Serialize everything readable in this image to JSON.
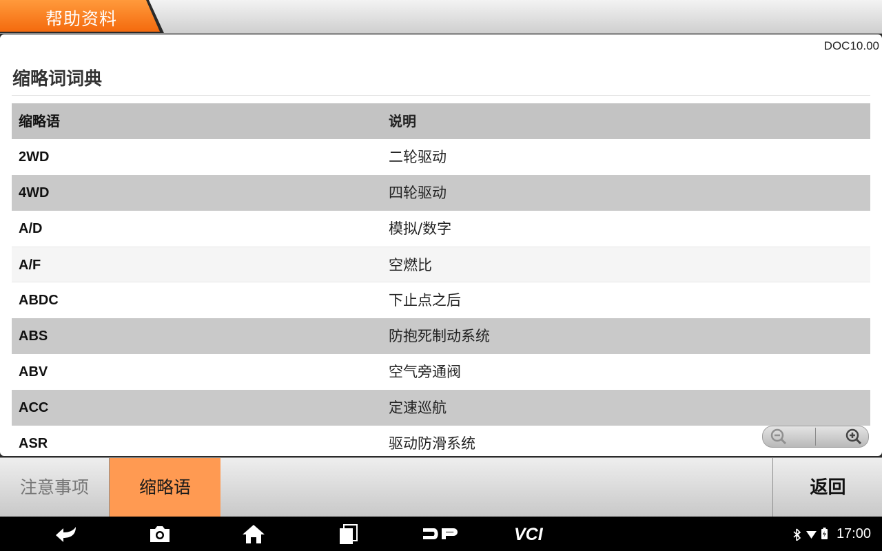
{
  "window": {
    "title": "帮助资料"
  },
  "document": {
    "version": "DOC10.00",
    "section_title": "缩略词词典"
  },
  "table": {
    "headers": [
      "缩略语",
      "说明"
    ],
    "rows": [
      {
        "abbr": "2WD",
        "desc": "二轮驱动"
      },
      {
        "abbr": "4WD",
        "desc": "四轮驱动"
      },
      {
        "abbr": "A/D",
        "desc": "模拟/数字"
      },
      {
        "abbr": "A/F",
        "desc": "空燃比"
      },
      {
        "abbr": "ABDC",
        "desc": "下止点之后"
      },
      {
        "abbr": "ABS",
        "desc": "防抱死制动系统"
      },
      {
        "abbr": "ABV",
        "desc": "空气旁通阀"
      },
      {
        "abbr": "ACC",
        "desc": "定速巡航"
      },
      {
        "abbr": "ASR",
        "desc": "驱动防滑系统"
      }
    ]
  },
  "zoom": {
    "out_icon": "zoom-out-icon",
    "in_icon": "zoom-in-icon"
  },
  "function_bar": {
    "notes_label": "注意事项",
    "abbr_label": "缩略语",
    "back_label": "返回",
    "active_color": "#ff9a52"
  },
  "nav_bar": {
    "icons": [
      "back-icon",
      "camera-icon",
      "home-icon",
      "recent-apps-icon",
      "dp-logo-icon",
      "vci-icon"
    ],
    "time": "17:00",
    "status_icons": [
      "bluetooth-icon",
      "wifi-icon",
      "battery-icon"
    ]
  },
  "colors": {
    "accent": "#ff7a1f",
    "header_row": "#c3c3c3"
  }
}
